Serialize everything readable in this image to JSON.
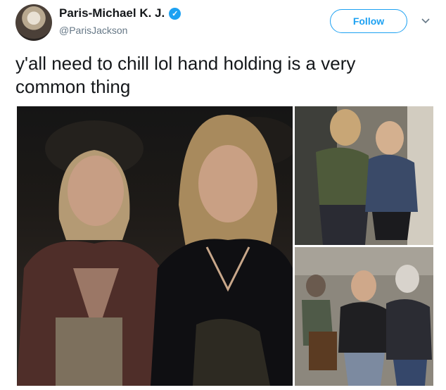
{
  "user": {
    "display_name": "Paris-Michael K. J.",
    "handle": "@ParisJackson",
    "verified": true
  },
  "actions": {
    "follow_label": "Follow"
  },
  "tweet": {
    "text": "y'all need to chill lol hand holding is a very common thing"
  },
  "media": {
    "photo_count": 3
  },
  "colors": {
    "accent": "#1da1f2",
    "text": "#14171a",
    "secondary": "#657786"
  }
}
